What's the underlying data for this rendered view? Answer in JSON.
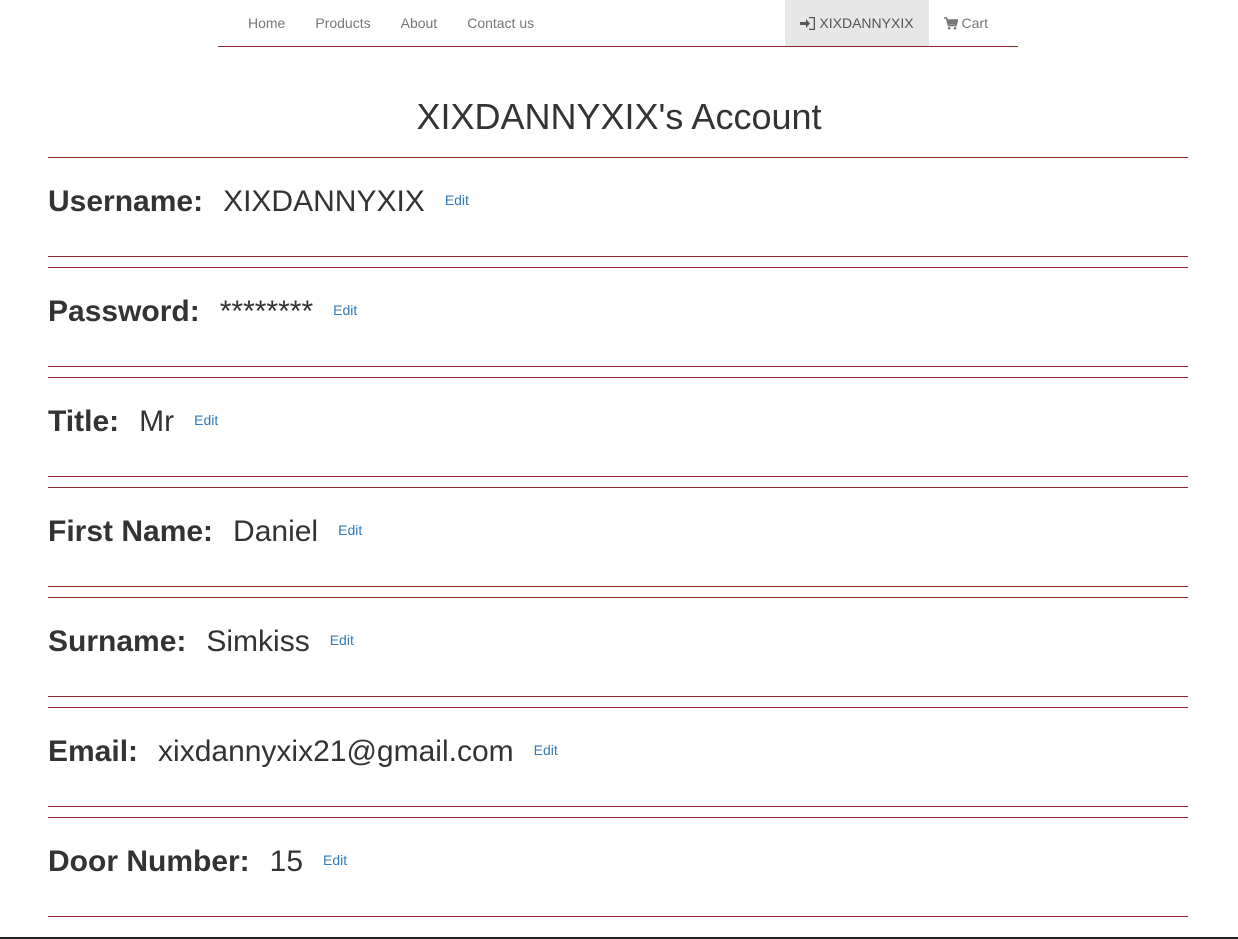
{
  "nav": {
    "links": [
      "Home",
      "Products",
      "About",
      "Contact us"
    ],
    "user_label": "XIXDANNYXIX",
    "cart_label": "Cart"
  },
  "page": {
    "title": "XIXDANNYXIX's Account"
  },
  "fields": [
    {
      "label": "Username:",
      "value": "XIXDANNYXIX",
      "edit": "Edit"
    },
    {
      "label": "Password:",
      "value": "********",
      "edit": "Edit"
    },
    {
      "label": "Title:",
      "value": "Mr",
      "edit": "Edit"
    },
    {
      "label": "First Name:",
      "value": "Daniel",
      "edit": "Edit"
    },
    {
      "label": "Surname:",
      "value": "Simkiss",
      "edit": "Edit"
    },
    {
      "label": "Email:",
      "value": "xixdannyxix21@gmail.com",
      "edit": "Edit"
    },
    {
      "label": "Door Number:",
      "value": "15",
      "edit": "Edit"
    }
  ],
  "colors": {
    "divider": "#8b2a2a",
    "link": "#337ab7",
    "nav_active_bg": "#e7e7e7"
  },
  "icons": {
    "user": "sign-in-icon",
    "cart": "cart-icon"
  }
}
